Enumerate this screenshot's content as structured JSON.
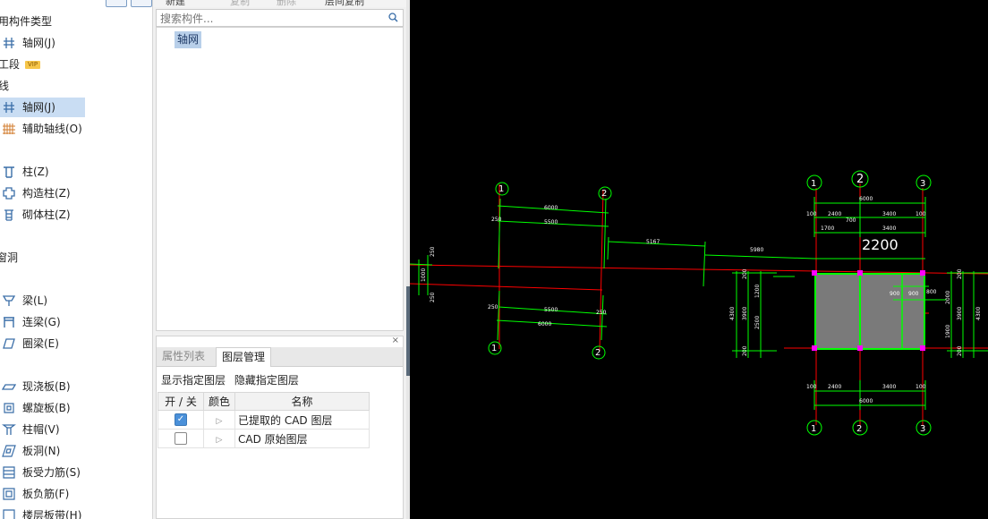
{
  "left_panel": {
    "header_partial": "用构件类型",
    "section_stage": "工段",
    "vip_badge": "VIP",
    "section_axis": "线",
    "section_wall_openings": "窗洞",
    "items": {
      "axis_top": "轴网(J)",
      "axis_grid": "轴网(J)",
      "aux_axis": "辅助轴线(O)",
      "column": "柱(Z)",
      "struct_column": "构造柱(Z)",
      "masonry_column": "砌体柱(Z)",
      "beam": "梁(L)",
      "link_beam": "连梁(G)",
      "ring_beam": "圈梁(E)",
      "cast_slab": "现浇板(B)",
      "spiral_slab": "螺旋板(B)",
      "column_cap": "柱帽(V)",
      "slab_hole": "板洞(N)",
      "slab_rebar": "板受力筋(S)",
      "slab_neg_rebar": "板负筋(F)",
      "floor_band": "楼层板带(H)"
    }
  },
  "toolbar": {
    "new": "新建",
    "copy": "复制",
    "delete": "删除",
    "interlayer_copy": "层间复制"
  },
  "search": {
    "placeholder": "搜索构件..."
  },
  "component_list": {
    "selected_item": "轴网"
  },
  "panel": {
    "close": "×",
    "tabs": [
      "属性列表",
      "图层管理"
    ],
    "actions": {
      "show_layer": "显示指定图层",
      "hide_layer": "隐藏指定图层"
    },
    "columns": {
      "toggle": "开 / 关",
      "color": "颜色",
      "name": "名称"
    },
    "rows": [
      {
        "checked": true,
        "name": "已提取的 CAD 图层"
      },
      {
        "checked": false,
        "name": "CAD 原始图层"
      }
    ]
  },
  "cad": {
    "colors": {
      "grid": "#00ff00",
      "red_axis": "#ff0000",
      "fill": "#7a7a7a",
      "text": "#ffffff",
      "magenta": "#ff00ff"
    },
    "left_axis_labels": [
      "1",
      "2",
      "1",
      "2"
    ],
    "right_axis_labels": [
      "1",
      "2",
      "3",
      "1",
      "2",
      "3",
      "1"
    ],
    "dims": {
      "d6000": "6000",
      "d5500": "5500",
      "d250": "250",
      "d5167": "5167",
      "d5980": "5980",
      "d100": "100",
      "d2400": "2400",
      "d3400": "3400",
      "d700": "700",
      "d1700": "1700",
      "d900": "900",
      "d800": "800",
      "d2000": "2000",
      "d3900": "3900",
      "d4300": "4300",
      "d1900": "1900",
      "d1200": "1200",
      "d2500": "2500",
      "d200": "200",
      "d1000": "1000",
      "big2200": "2200"
    }
  }
}
